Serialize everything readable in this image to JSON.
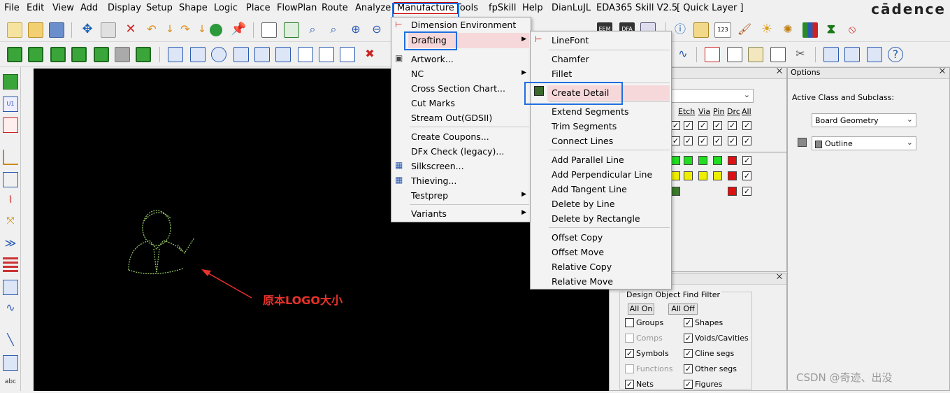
{
  "menubar": {
    "items": [
      "File",
      "Edit",
      "View",
      "Add",
      "Display",
      "Setup",
      "Shape",
      "Logic",
      "Place",
      "FlowPlan",
      "Route",
      "Analyze",
      "Manufacture",
      "Tools",
      "fpSkill",
      "Help",
      "DianLuJL",
      "EDA365 Skill V2.5",
      "[ Quick Layer ]"
    ],
    "brand": "cādence"
  },
  "manufacture_menu": {
    "items": [
      "Dimension Environment",
      "Drafting",
      "Artwork...",
      "NC",
      "Cross Section Chart...",
      "Cut Marks",
      "Stream Out(GDSII)",
      "Create Coupons...",
      "DFx Check (legacy)...",
      "Silkscreen...",
      "Thieving...",
      "Testprep",
      "Variants"
    ]
  },
  "drafting_menu": {
    "items": [
      "LineFont",
      "Chamfer",
      "Fillet",
      "Create Detail",
      "Extend Segments",
      "Trim Segments",
      "Connect Lines",
      "Add Parallel Line",
      "Add Perpendicular Line",
      "Add Tangent Line",
      "Delete by Line",
      "Delete by Rectangle",
      "Offset Copy",
      "Offset Move",
      "Relative Copy",
      "Relative Move"
    ]
  },
  "canvas": {
    "annotation": "原本LOGO大小",
    "annotation_color": "#e8322a",
    "logo_color": "#9bd36a"
  },
  "visibility_panel": {
    "columns": [
      "Etch",
      "Via",
      "Pin",
      "Drc",
      "All"
    ]
  },
  "options_panel": {
    "title": "Options",
    "active_class_label": "Active Class and Subclass:",
    "class_value": "Board Geometry",
    "subclass_value": "Outline"
  },
  "find_panel": {
    "title": "Design Object Find Filter",
    "all_on": "All On",
    "all_off": "All Off",
    "left": [
      {
        "label": "Groups",
        "checked": false,
        "enabled": true
      },
      {
        "label": "Comps",
        "checked": false,
        "enabled": false
      },
      {
        "label": "Symbols",
        "checked": true,
        "enabled": true
      },
      {
        "label": "Functions",
        "checked": false,
        "enabled": false
      },
      {
        "label": "Nets",
        "checked": true,
        "enabled": true
      }
    ],
    "right": [
      {
        "label": "Shapes",
        "checked": true
      },
      {
        "label": "Voids/Cavities",
        "checked": true
      },
      {
        "label": "Cline segs",
        "checked": true
      },
      {
        "label": "Other segs",
        "checked": true
      },
      {
        "label": "Figures",
        "checked": true
      }
    ]
  },
  "watermark": "CSDN @奇迹、出没",
  "colors": {
    "highlight": "#f7d8da",
    "annotation_box": "#1f6fe0"
  }
}
